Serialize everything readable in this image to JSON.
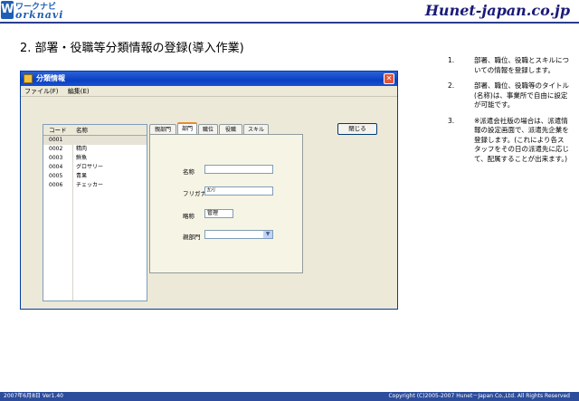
{
  "header": {
    "logo_top": "ワークナビ",
    "logo_bottom": "orknavi",
    "brand": "Hunet-japan.co.jp"
  },
  "page_title": "2. 部署・役職等分類情報の登録(導入作業)",
  "dialog": {
    "title": "分類情報",
    "menu": [
      "ファイル(F)",
      "編集(E)"
    ],
    "list": {
      "headers": [
        "コード",
        "名称"
      ],
      "rows": [
        {
          "code": "0001",
          "name": ""
        },
        {
          "code": "0002",
          "name": "精肉"
        },
        {
          "code": "0003",
          "name": "鮮魚"
        },
        {
          "code": "0004",
          "name": "グロサリー"
        },
        {
          "code": "0005",
          "name": "青果"
        },
        {
          "code": "0006",
          "name": "チェッカー"
        }
      ]
    },
    "tabs": [
      "親部門",
      "部門",
      "職位",
      "役職",
      "スキル"
    ],
    "active_tab": "部門",
    "form": {
      "name_label": "名称",
      "name_value": "",
      "kana_label": "フリガナ",
      "kana_value": "ｶﾝﾘ",
      "short_label": "略称",
      "short_value": "管理",
      "parent_label": "親部門",
      "parent_value": ""
    },
    "close_button": "閉じる"
  },
  "notes": [
    {
      "num": "1.",
      "text": "部署、職位、役職とスキルについての情報を登録します。"
    },
    {
      "num": "2.",
      "text": "部署、職位、役職等のタイトル(名称)は、事業所で自由に設定が可能です。"
    },
    {
      "num": "3.",
      "text": "※派遣会社版の場合は、派遣情報の設定画面で、派遣先企業を登録します。(これにより各スタッフをその日の派遣先に応じて、配属することが出来ます。)"
    }
  ],
  "footer": {
    "left": "2007年6月8日 Ver1.40",
    "right": "Copyright (C)2005-2007 Hunet－Japan Co.,Ltd. All Rights Reserved"
  },
  "colors": {
    "brand_blue": "#1f5fb5",
    "footer_bar": "#2d4c9c",
    "titlebar": "#0a3fc0",
    "dialog_bg": "#ece9d8"
  }
}
